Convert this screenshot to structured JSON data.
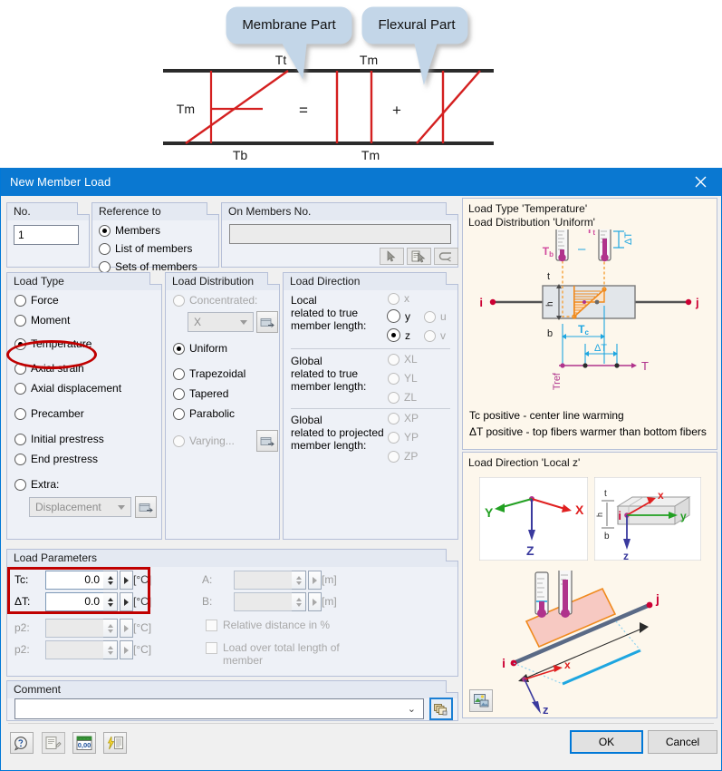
{
  "illustration": {
    "callouts": [
      {
        "label": "Membrane Part"
      },
      {
        "label": "Flexural Part"
      }
    ],
    "labels": {
      "tt": "Tt",
      "tm_left": "Tm",
      "tb": "Tb",
      "tm_top": "Tm",
      "tm_bottom": "Tm",
      "equals": "=",
      "plus": "+"
    }
  },
  "dialog": {
    "title": "New Member Load",
    "close_icon": "close-icon"
  },
  "no_group": {
    "title": "No.",
    "value": "1"
  },
  "reference": {
    "title": "Reference to",
    "options": [
      {
        "label": "Members",
        "checked": true
      },
      {
        "label": "List of members",
        "checked": false
      },
      {
        "label": "Sets of members",
        "checked": false
      }
    ]
  },
  "on_members": {
    "title": "On Members No.",
    "value": "",
    "buttons": [
      "pick-member-icon",
      "pick-from-list-icon",
      "select-all-icon"
    ]
  },
  "load_type": {
    "title": "Load Type",
    "options": [
      {
        "label": "Force",
        "checked": false,
        "disabled": false
      },
      {
        "label": "Moment",
        "checked": false,
        "disabled": false
      },
      {
        "label": "Temperature",
        "checked": true,
        "disabled": false
      },
      {
        "label": "Axial strain",
        "checked": false,
        "disabled": false
      },
      {
        "label": "Axial displacement",
        "checked": false,
        "disabled": false
      },
      {
        "label": "Precamber",
        "checked": false,
        "disabled": false
      },
      {
        "label": "Initial prestress",
        "checked": false,
        "disabled": false
      },
      {
        "label": "End prestress",
        "checked": false,
        "disabled": false
      },
      {
        "label": "Extra:",
        "checked": false,
        "disabled": false
      }
    ],
    "extra_combo_value": "Displacement"
  },
  "load_distribution": {
    "title": "Load Distribution",
    "concentrated_label": "Concentrated:",
    "concentrated_combo_value": "X",
    "options": [
      {
        "label": "Uniform",
        "checked": true,
        "disabled": false
      },
      {
        "label": "Trapezoidal",
        "checked": false,
        "disabled": false
      },
      {
        "label": "Tapered",
        "checked": false,
        "disabled": false
      },
      {
        "label": "Parabolic",
        "checked": false,
        "disabled": false
      },
      {
        "label": "Varying...",
        "checked": false,
        "disabled": true
      }
    ]
  },
  "load_direction": {
    "title": "Load Direction",
    "local_label_lines": [
      "Local",
      "related to true",
      "member length:"
    ],
    "global_true_label_lines": [
      "Global",
      "related to true",
      "member length:"
    ],
    "global_proj_label_lines": [
      "Global",
      "related to projected",
      "member length:"
    ],
    "local_options": [
      {
        "label": "x",
        "checked": false,
        "disabled": true
      },
      {
        "label": "y",
        "checked": false,
        "disabled": false
      },
      {
        "label": "z",
        "checked": true,
        "disabled": false
      },
      {
        "label": "u",
        "checked": false,
        "disabled": true
      },
      {
        "label": "v",
        "checked": false,
        "disabled": true
      }
    ],
    "global_true_options": [
      {
        "label": "XL",
        "checked": false,
        "disabled": true
      },
      {
        "label": "YL",
        "checked": false,
        "disabled": true
      },
      {
        "label": "ZL",
        "checked": false,
        "disabled": true
      }
    ],
    "global_proj_options": [
      {
        "label": "XP",
        "checked": false,
        "disabled": true
      },
      {
        "label": "YP",
        "checked": false,
        "disabled": true
      },
      {
        "label": "ZP",
        "checked": false,
        "disabled": true
      }
    ]
  },
  "load_parameters": {
    "title": "Load Parameters",
    "rows": [
      {
        "label": "Tc:",
        "value": "0.0",
        "unit": "[°C]",
        "disabled": false
      },
      {
        "label": "ΔT:",
        "value": "0.0",
        "unit": "[°C]",
        "disabled": false
      },
      {
        "label": "p2:",
        "value": "",
        "unit": "[°C]",
        "disabled": true
      },
      {
        "label": "p2:",
        "value": "",
        "unit": "[°C]",
        "disabled": true
      }
    ],
    "right_rows": [
      {
        "label": "A:",
        "value": "",
        "unit": "[m]",
        "disabled": true
      },
      {
        "label": "B:",
        "value": "",
        "unit": "[m]",
        "disabled": true
      }
    ],
    "checkboxes": [
      {
        "label": "Relative distance in %",
        "checked": false,
        "disabled": true
      },
      {
        "label": "Load over total length of",
        "label2": "member",
        "checked": false,
        "disabled": true
      }
    ]
  },
  "comment": {
    "title": "Comment",
    "value": "",
    "button_icon": "copy-comment-icon"
  },
  "toolbar": {
    "buttons": [
      {
        "icon": "help-icon",
        "enabled": true
      },
      {
        "icon": "edit-icon",
        "enabled": false
      },
      {
        "icon": "units-icon",
        "enabled": true
      },
      {
        "icon": "wizard-icon",
        "enabled": true
      }
    ]
  },
  "footer": {
    "ok_label": "OK",
    "cancel_label": "Cancel"
  },
  "info_top": {
    "title": "Load Type 'Temperature'",
    "line2": "Load Distribution 'Uniform'",
    "note1": "Tc positive - center line warming",
    "note2": "ΔT positive - top fibers warmer than bottom fibers",
    "diagram_labels": {
      "i": "i",
      "j": "j",
      "t": "t",
      "h": "h",
      "b": "b",
      "tb": "Tb",
      "tt": "Tt",
      "tc": "Tc",
      "dt": "ΔT",
      "tref": "Tref",
      "taxis": "T",
      "minus": "-"
    }
  },
  "info_bottom": {
    "title": "Load Direction 'Local z'",
    "axes_global": {
      "x": "X",
      "y": "Y",
      "z": "Z"
    },
    "axes_local": {
      "x": "x",
      "y": "y",
      "z": "z",
      "i": "i",
      "t": "t",
      "h": "h",
      "b": "b"
    },
    "member": {
      "i": "i",
      "j": "j",
      "x": "x",
      "z": "z"
    },
    "button_icon": "picture-settings-icon"
  },
  "colors": {
    "title_blue": "#0a78d1",
    "accent_blue": "#0078d7",
    "red_highlight": "#c00000",
    "diagram_red": "#d42020",
    "callout_fill": "#c3d6e8",
    "panel_bg": "#eef1f7",
    "info_bg": "#fdf7ec",
    "orange": "#f08a1e",
    "magenta": "#b0338c",
    "cyan": "#1ea6e0"
  }
}
